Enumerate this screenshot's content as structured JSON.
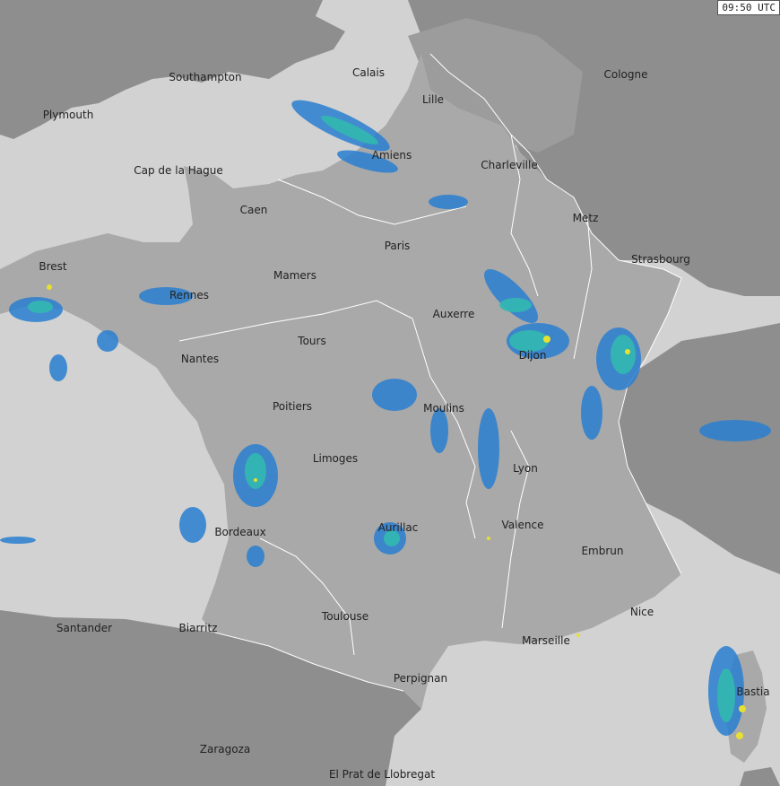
{
  "timestamp": "09:50 UTC",
  "cities": [
    {
      "id": "southampton",
      "name": "Southampton"
    },
    {
      "id": "calais",
      "name": "Calais"
    },
    {
      "id": "plymouth",
      "name": "Plymouth"
    },
    {
      "id": "lille",
      "name": "Lille"
    },
    {
      "id": "cologne",
      "name": "Cologne"
    },
    {
      "id": "amiens",
      "name": "Amiens"
    },
    {
      "id": "charleville",
      "name": "Charleville"
    },
    {
      "id": "cap-de-la-hague",
      "name": "Cap de la Hague"
    },
    {
      "id": "caen",
      "name": "Caen"
    },
    {
      "id": "metz",
      "name": "Metz"
    },
    {
      "id": "paris",
      "name": "Paris"
    },
    {
      "id": "strasbourg",
      "name": "Strasbourg"
    },
    {
      "id": "brest",
      "name": "Brest"
    },
    {
      "id": "mamers",
      "name": "Mamers"
    },
    {
      "id": "rennes",
      "name": "Rennes"
    },
    {
      "id": "auxerre",
      "name": "Auxerre"
    },
    {
      "id": "tours",
      "name": "Tours"
    },
    {
      "id": "dijon",
      "name": "Dijon"
    },
    {
      "id": "nantes",
      "name": "Nantes"
    },
    {
      "id": "poitiers",
      "name": "Poitiers"
    },
    {
      "id": "moulins",
      "name": "Moulins"
    },
    {
      "id": "limoges",
      "name": "Limoges"
    },
    {
      "id": "lyon",
      "name": "Lyon"
    },
    {
      "id": "aurillac",
      "name": "Aurillac"
    },
    {
      "id": "valence",
      "name": "Valence"
    },
    {
      "id": "bordeaux",
      "name": "Bordeaux"
    },
    {
      "id": "embrun",
      "name": "Embrun"
    },
    {
      "id": "nice",
      "name": "Nice"
    },
    {
      "id": "toulouse",
      "name": "Toulouse"
    },
    {
      "id": "santander",
      "name": "Santander"
    },
    {
      "id": "biarritz",
      "name": "Biarritz"
    },
    {
      "id": "marseille",
      "name": "Marseille"
    },
    {
      "id": "bastia",
      "name": "Bastia"
    },
    {
      "id": "perpignan",
      "name": "Perpignan"
    },
    {
      "id": "zaragoza",
      "name": "Zaragoza"
    },
    {
      "id": "el-prat",
      "name": "El Prat de Llobregat"
    }
  ],
  "colors": {
    "sea": "#d2d2d2",
    "land_france": "#a9a9a9",
    "land_other": "#8e8e8e",
    "land_belgium": "#9c9c9c",
    "border": "#ffffff",
    "rain_light": "#2a7fd0",
    "rain_moderate": "#33b8b0",
    "rain_heavy": "#e8e030"
  }
}
